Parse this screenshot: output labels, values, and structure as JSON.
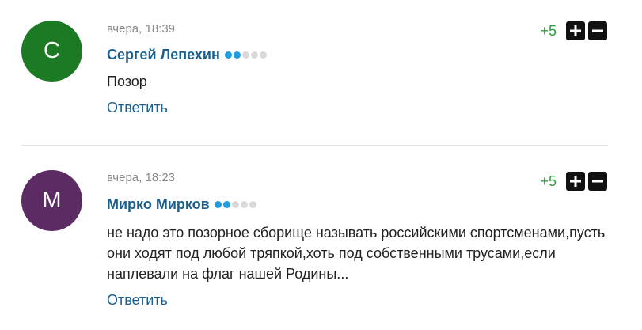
{
  "comments": [
    {
      "avatar_letter": "С",
      "avatar_color": "#1d7a24",
      "time": "вчера, 18:39",
      "author": "Сергей Лепехин",
      "rank_filled": 2,
      "rank_total": 5,
      "text": "Позор",
      "reply_label": "Ответить",
      "score": "+5"
    },
    {
      "avatar_letter": "М",
      "avatar_color": "#5c2b63",
      "time": "вчера, 18:23",
      "author": "Мирко Мирков",
      "rank_filled": 2,
      "rank_total": 5,
      "text": "не надо это позорное сборище называть российскими спортсменами,пусть они ходят под любой тряпкой,хоть под собственными трусами,если наплевали на флаг нашей Родины...",
      "reply_label": "Ответить",
      "score": "+5"
    }
  ],
  "icons": {
    "upvote": "plus-icon",
    "downvote": "minus-icon"
  },
  "colors": {
    "author": "#1a5f8e",
    "score_positive": "#2e9e3e",
    "rank_on": "#1e9be1",
    "rank_off": "#d9d9d9"
  }
}
